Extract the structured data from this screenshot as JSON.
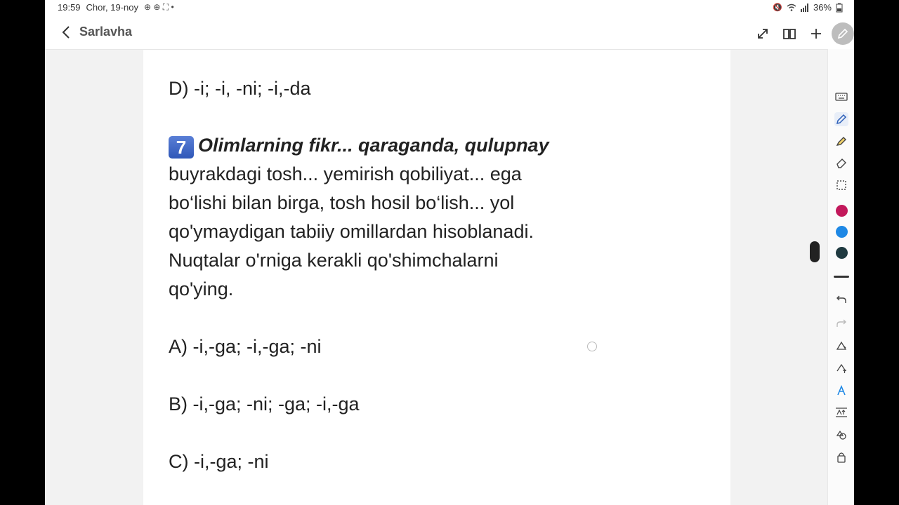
{
  "status": {
    "time": "19:59",
    "date": "Chor, 19-noy",
    "battery": "36%"
  },
  "header": {
    "title": "Sarlavha"
  },
  "content": {
    "prev_option_d": "D) -i; -i, -ni; -i,-da",
    "question_number": "7",
    "question_title": "Olimlarning fikr... qaraganda, qulupnay",
    "question_lines": [
      "buyrakdagi tosh... yemirish qobiliyat... ega",
      "bo‘lishi bilan birga, tosh hosil bo‘lish... yol",
      "qo'ymaydigan tabiiy omillardan hisoblanadi.",
      "Nuqtalar o'rniga kerakli qo'shimchalarni",
      "qo'ying."
    ],
    "options": {
      "a": "A) -i,-ga; -i,-ga; -ni",
      "b": "B) -i,-ga; -ni; -ga; -i,-ga",
      "c": "C) -i,-ga; -ni"
    }
  },
  "colors": {
    "pen_magenta": "#c2185b",
    "pen_blue": "#1e88e5",
    "pen_dark": "#1f3a40",
    "badge_blue": "#3d63c4"
  },
  "toolbar": {
    "icons": [
      "keyboard-icon",
      "pen-icon",
      "highlighter-icon",
      "eraser-icon",
      "lasso-icon",
      "undo-icon",
      "redo-icon",
      "shapes-pen-icon",
      "text-pen-icon",
      "handwriting-icon",
      "text-size-icon",
      "shapes-icon",
      "lock-icon"
    ]
  }
}
